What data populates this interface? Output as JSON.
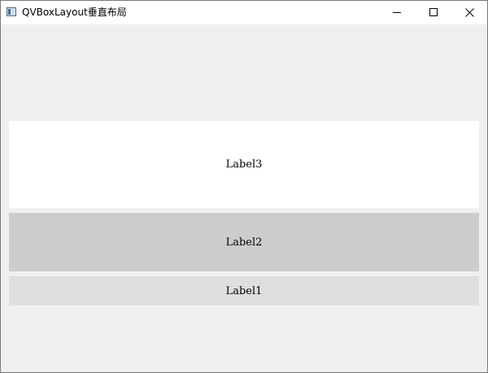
{
  "window": {
    "title": "QVBoxLayout垂直布局",
    "app_icon": "window-icon",
    "controls": {
      "minimize_icon": "minimize-icon",
      "maximize_icon": "maximize-icon",
      "close_icon": "close-icon"
    }
  },
  "labels": [
    {
      "text": "Label3",
      "background": "#ffffff"
    },
    {
      "text": "Label2",
      "background": "#cccccc"
    },
    {
      "text": "Label1",
      "background": "#dedede"
    }
  ],
  "colors": {
    "window_background": "#efefef",
    "titlebar_background": "#ffffff"
  }
}
